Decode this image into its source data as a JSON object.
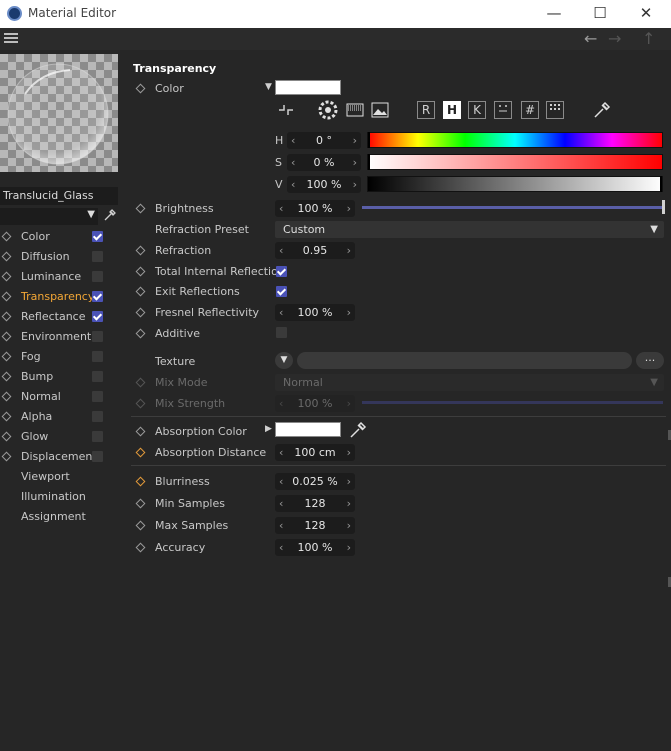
{
  "window": {
    "title": "Material Editor",
    "minimize": "—",
    "maximize": "☐",
    "close": "✕"
  },
  "toolbar": {
    "back": "←",
    "forward": "→",
    "up": "↑"
  },
  "material": {
    "name": "Translucid_Glass"
  },
  "channels": [
    {
      "label": "Color",
      "checked": true
    },
    {
      "label": "Diffusion",
      "checked": false
    },
    {
      "label": "Luminance",
      "checked": false
    },
    {
      "label": "Transparency",
      "checked": true,
      "active": true
    },
    {
      "label": "Reflectance",
      "checked": true
    },
    {
      "label": "Environment",
      "checked": false
    },
    {
      "label": "Fog",
      "checked": false
    },
    {
      "label": "Bump",
      "checked": false
    },
    {
      "label": "Normal",
      "checked": false
    },
    {
      "label": "Alpha",
      "checked": false
    },
    {
      "label": "Glow",
      "checked": false
    },
    {
      "label": "Displacement",
      "checked": false
    },
    {
      "label": "Viewport"
    },
    {
      "label": "Illumination"
    },
    {
      "label": "Assignment"
    }
  ],
  "colors": {
    "accent": "#f3a736",
    "checkbox": "#4a52b6",
    "background": "#262626"
  },
  "transparency": {
    "section_title": "Transparency",
    "color_label": "Color",
    "mode_buttons": [
      "R",
      "H",
      "K"
    ],
    "mode_selected": "H",
    "h_label": "H",
    "h_value": "0 °",
    "s_label": "S",
    "s_value": "0 %",
    "v_label": "V",
    "v_value": "100 %",
    "brightness_label": "Brightness",
    "brightness_value": "100 %",
    "refraction_preset_label": "Refraction Preset",
    "refraction_preset_value": "Custom",
    "refraction_label": "Refraction",
    "refraction_value": "0.95",
    "tir_label": "Total Internal Reflection",
    "tir_checked": true,
    "exit_reflections_label": "Exit Reflections",
    "exit_reflections_checked": true,
    "fresnel_label": "Fresnel Reflectivity",
    "fresnel_value": "100 %",
    "additive_label": "Additive",
    "additive_checked": false,
    "texture_label": "Texture",
    "texture_more": "...",
    "mix_mode_label": "Mix Mode",
    "mix_mode_value": "Normal",
    "mix_strength_label": "Mix Strength",
    "mix_strength_value": "100 %",
    "absorption_color_label": "Absorption Color",
    "absorption_distance_label": "Absorption Distance",
    "absorption_distance_value": "100 cm",
    "blurriness_label": "Blurriness",
    "blurriness_value": "0.025 %",
    "min_samples_label": "Min Samples",
    "min_samples_value": "128",
    "max_samples_label": "Max Samples",
    "max_samples_value": "128",
    "accuracy_label": "Accuracy",
    "accuracy_value": "100 %"
  }
}
